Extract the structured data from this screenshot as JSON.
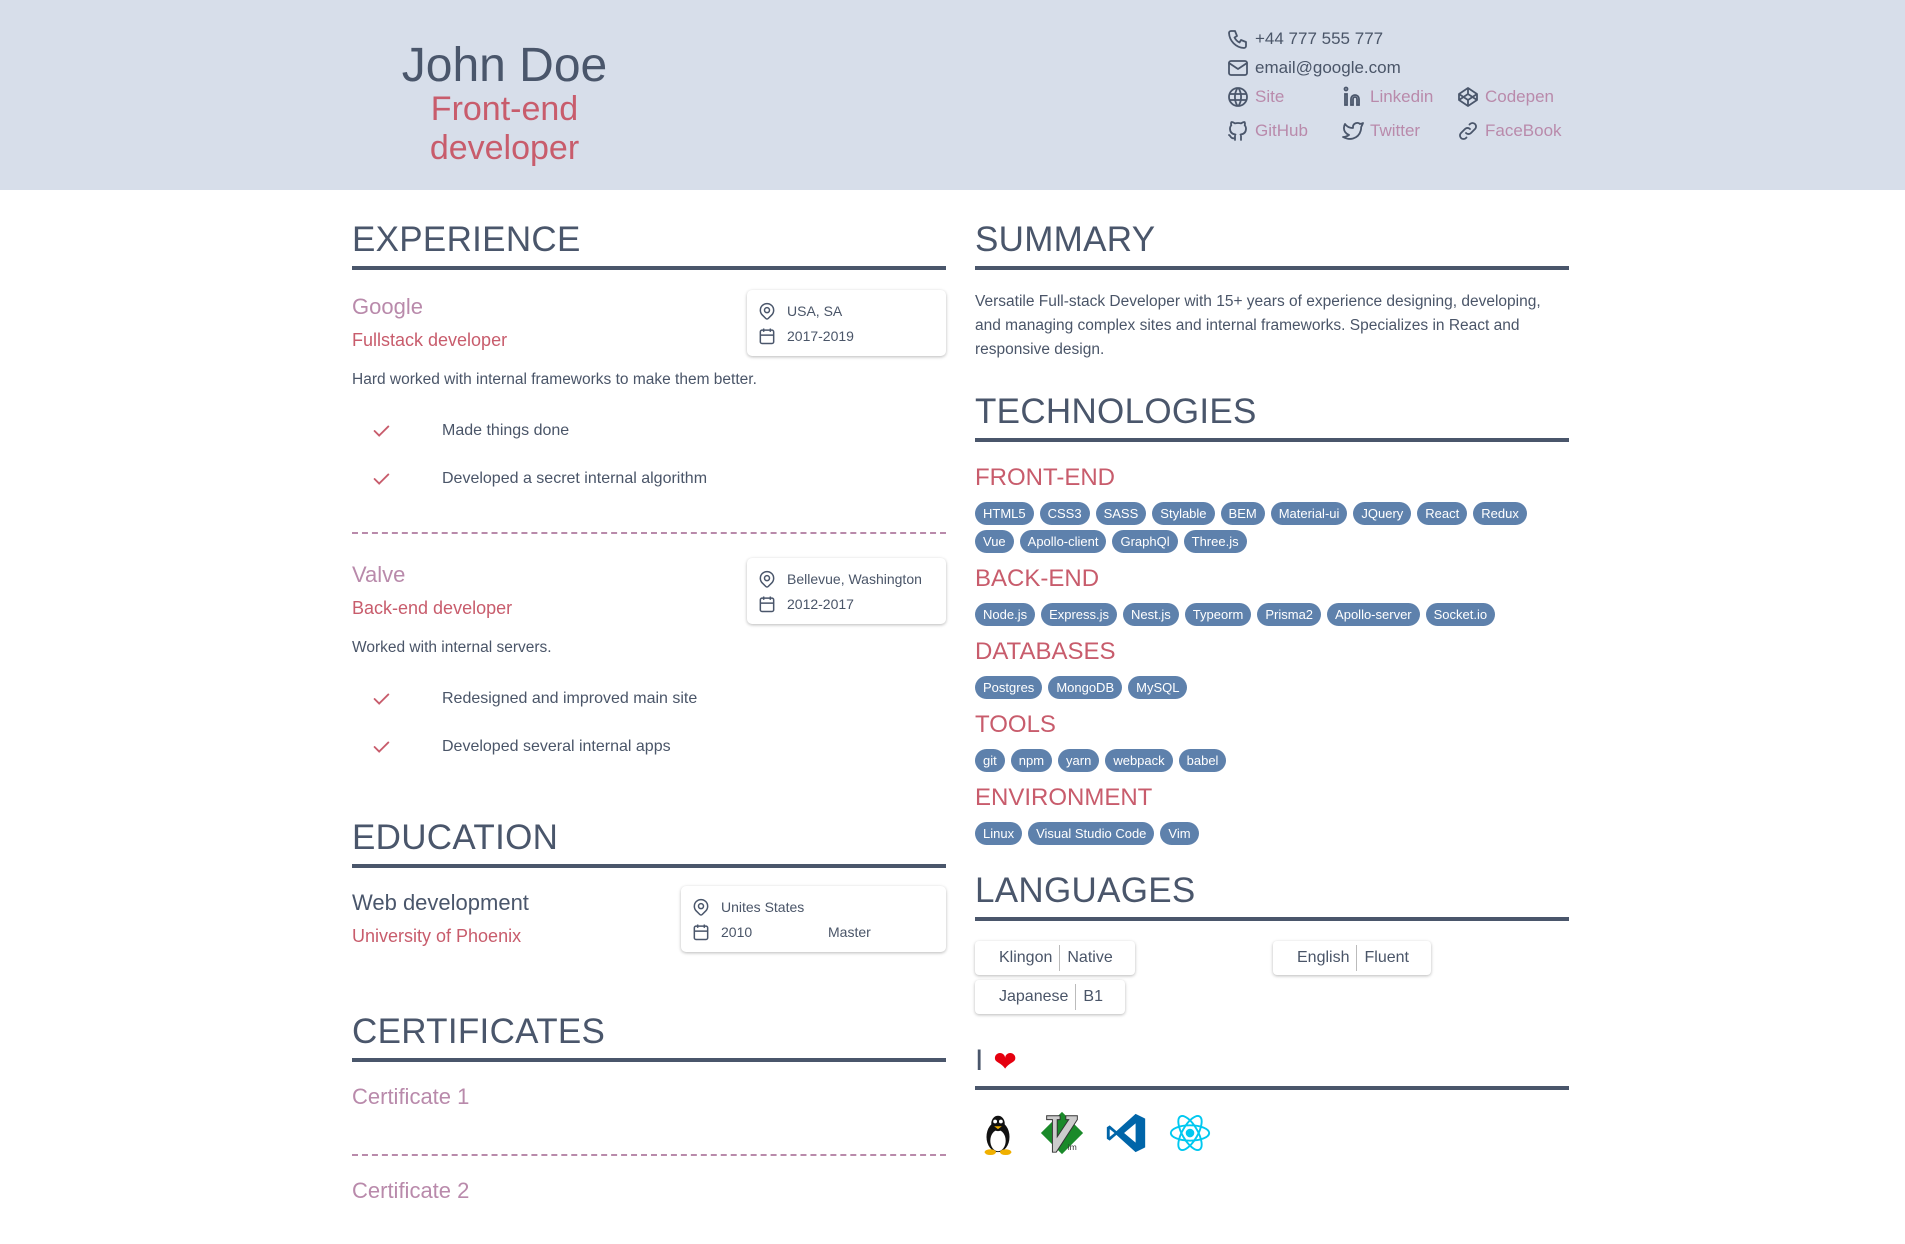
{
  "header": {
    "name": "John Doe",
    "role": "Front-end developer",
    "phone": "+44 777 555 777",
    "email": "email@google.com",
    "social": [
      {
        "label": "Site",
        "icon": "globe-icon"
      },
      {
        "label": "Linkedin",
        "icon": "linkedin-icon"
      },
      {
        "label": "Codepen",
        "icon": "codepen-icon"
      },
      {
        "label": "GitHub",
        "icon": "github-icon"
      },
      {
        "label": "Twitter",
        "icon": "twitter-icon"
      },
      {
        "label": "FaceBook",
        "icon": "link-icon"
      }
    ]
  },
  "experience": {
    "title": "EXPERIENCE",
    "jobs": [
      {
        "company": "Google",
        "role": "Fullstack developer",
        "location": "USA, SA",
        "period": "2017-2019",
        "description": "Hard worked with internal frameworks to make them better.",
        "achievements": [
          "Made things done",
          "Developed a secret internal algorithm"
        ]
      },
      {
        "company": "Valve",
        "role": "Back-end developer",
        "location": "Bellevue, Washington",
        "period": "2012-2017",
        "description": "Worked with internal servers.",
        "achievements": [
          "Redesigned and improved main site",
          "Developed several internal apps"
        ]
      }
    ]
  },
  "education": {
    "title": "EDUCATION",
    "items": [
      {
        "field": "Web development",
        "school": "University of Phoenix",
        "location": "Unites States",
        "year": "2010",
        "degree": "Master"
      }
    ]
  },
  "certificates": {
    "title": "CERTIFICATES",
    "items": [
      "Certificate 1",
      "Certificate 2"
    ]
  },
  "summary": {
    "title": "SUMMARY",
    "text": "Versatile Full-stack Developer with 15+ years of experience designing, developing, and managing complex sites and internal frameworks. Specializes in React and responsive design."
  },
  "technologies": {
    "title": "TECHNOLOGIES",
    "groups": [
      {
        "name": "FRONT-END",
        "items": [
          "HTML5",
          "CSS3",
          "SASS",
          "Stylable",
          "BEM",
          "Material-ui",
          "JQuery",
          "React",
          "Redux",
          "Vue",
          "Apollo-client",
          "GraphQl",
          "Three.js"
        ]
      },
      {
        "name": "BACK-END",
        "items": [
          "Node.js",
          "Express.js",
          "Nest.js",
          "Typeorm",
          "Prisma2",
          "Apollo-server",
          "Socket.io"
        ]
      },
      {
        "name": "DATABASES",
        "items": [
          "Postgres",
          "MongoDB",
          "MySQL"
        ]
      },
      {
        "name": "TOOLS",
        "items": [
          "git",
          "npm",
          "yarn",
          "webpack",
          "babel"
        ]
      },
      {
        "name": "ENVIRONMENT",
        "items": [
          "Linux",
          "Visual Studio Code",
          "Vim"
        ]
      }
    ]
  },
  "languages": {
    "title": "LANGUAGES",
    "items": [
      {
        "language": "Klingon",
        "level": "Native"
      },
      {
        "language": "English",
        "level": "Fluent"
      },
      {
        "language": "Japanese",
        "level": "B1"
      }
    ]
  },
  "love": {
    "title": "I",
    "heart": "❤",
    "icons": [
      "linux-tux-icon",
      "vim-icon",
      "vscode-icon",
      "react-icon"
    ]
  },
  "colors": {
    "header_bg": "#d7deea",
    "heading": "#4a566b",
    "accent_red": "#c85c6c",
    "accent_mauve": "#b98aab",
    "chip": "#5e81ac"
  }
}
